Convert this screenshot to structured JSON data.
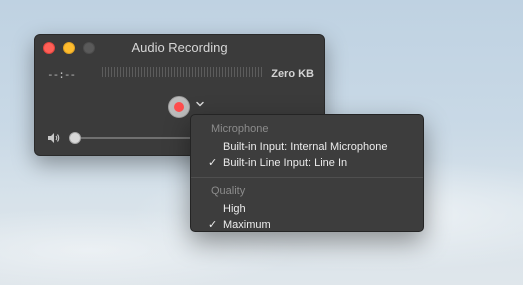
{
  "window": {
    "title": "Audio Recording",
    "time": "--:--",
    "file_size": "Zero KB"
  },
  "menu": {
    "sections": [
      {
        "header": "Microphone",
        "items": [
          {
            "label": "Built-in Input: Internal Microphone",
            "checked": false
          },
          {
            "label": "Built-in Line Input: Line In",
            "checked": true
          }
        ]
      },
      {
        "header": "Quality",
        "items": [
          {
            "label": "High",
            "checked": false
          },
          {
            "label": "Maximum",
            "checked": true
          }
        ]
      }
    ],
    "check_mark": "✓"
  },
  "icons": {
    "record": "record-icon",
    "options": "chevron-down-icon",
    "volume": "speaker-icon"
  },
  "colors": {
    "close": "#fe5f57",
    "minimize": "#febc2e",
    "record": "#ff4e4e",
    "window_bg": "#3b3b3b",
    "menu_bg": "#3d3d3d"
  }
}
